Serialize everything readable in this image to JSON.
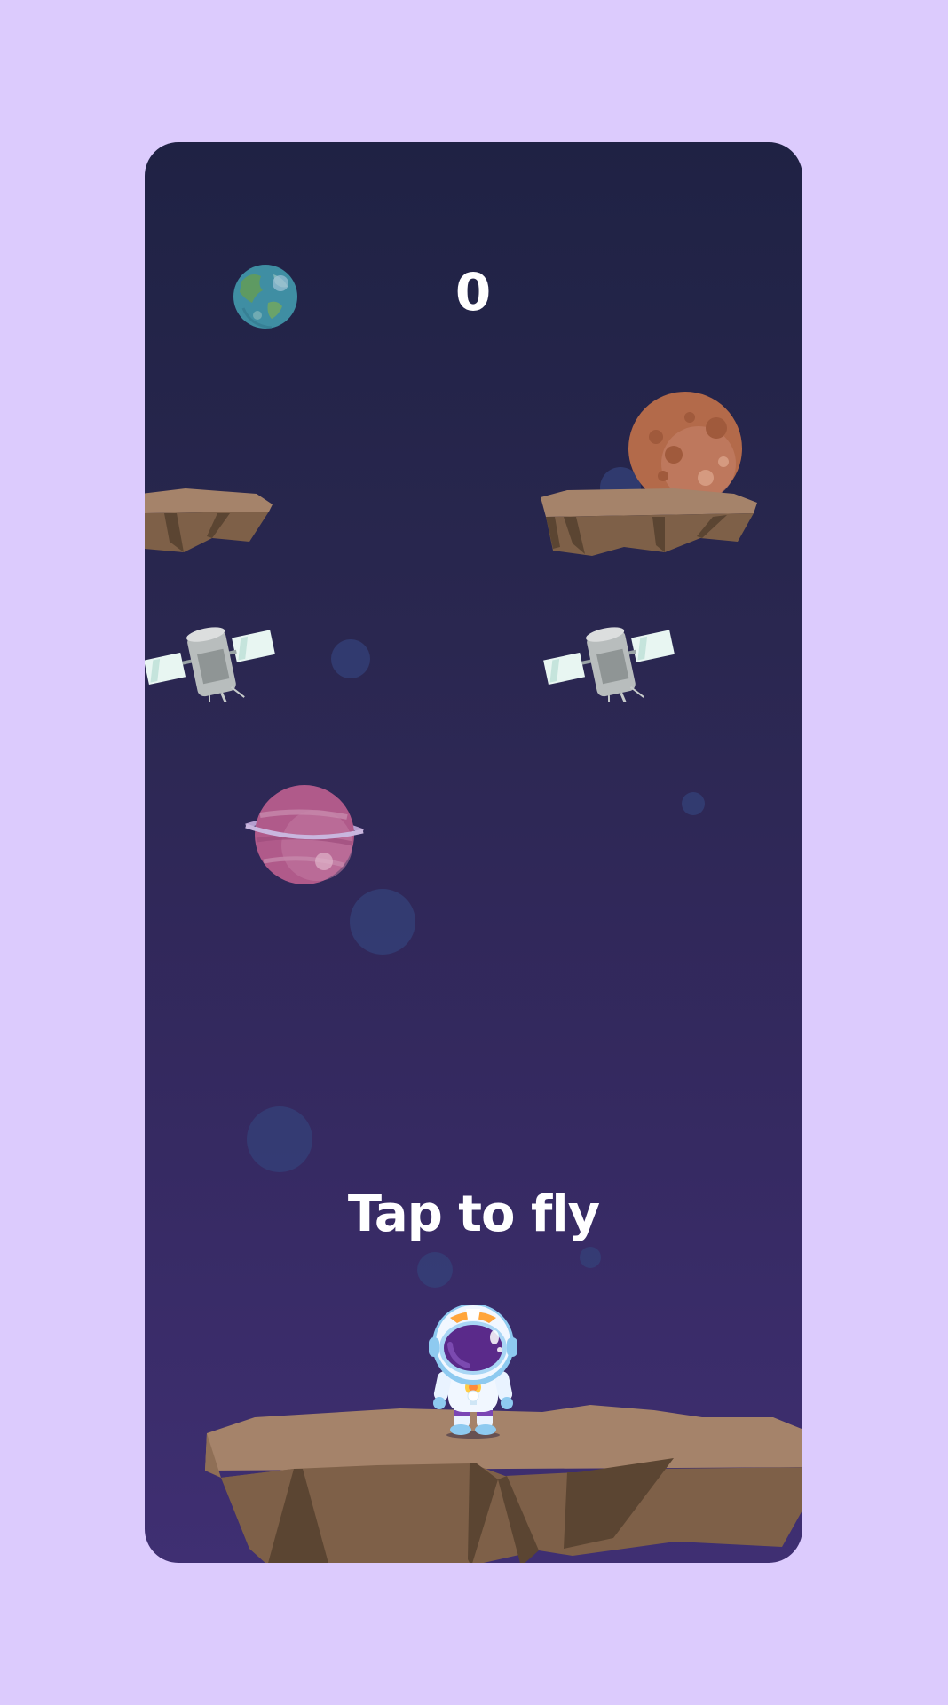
{
  "hud": {
    "score": "0"
  },
  "prompt": {
    "tap_text": "Tap to fly"
  },
  "colors": {
    "page_background": "#dccbfd",
    "sky_top": "#1f2244",
    "sky_bottom": "#3f2f72",
    "rock_top": "#a5836a",
    "rock_side": "#7e6048",
    "rock_shadow": "#5b4532",
    "astronaut_visor": "#5a2a8a",
    "text": "#ffffff"
  },
  "scene": {
    "objects": [
      {
        "name": "earth-planet",
        "icon": "planet-earth"
      },
      {
        "name": "mars-planet",
        "icon": "planet-cratered-orange"
      },
      {
        "name": "ringed-pink-planet",
        "icon": "planet-ringed"
      },
      {
        "name": "floating-rock-left",
        "icon": "rock-platform"
      },
      {
        "name": "floating-rock-right",
        "icon": "rock-platform"
      },
      {
        "name": "satellite-left",
        "icon": "satellite"
      },
      {
        "name": "satellite-right",
        "icon": "satellite"
      },
      {
        "name": "ground-rock",
        "icon": "rock-platform-large"
      },
      {
        "name": "astronaut-player",
        "icon": "astronaut"
      }
    ]
  }
}
